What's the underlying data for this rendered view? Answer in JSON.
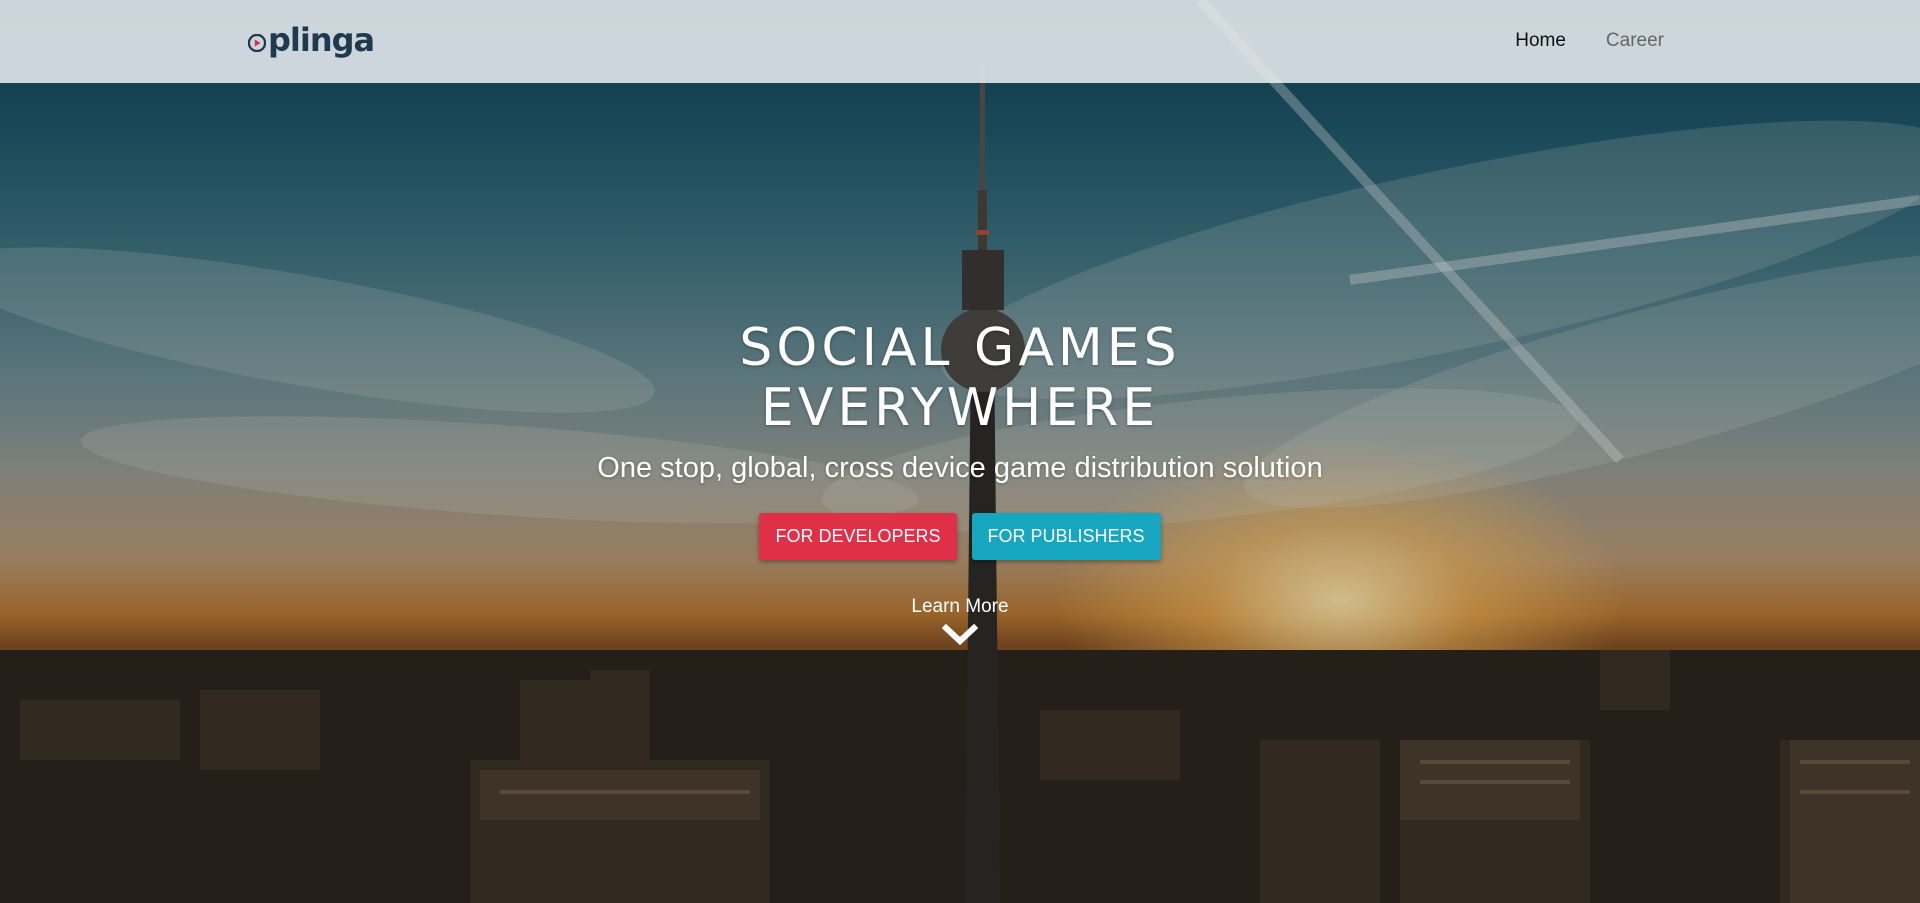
{
  "nav": {
    "logo_text": "plinga",
    "links": [
      {
        "label": "Home",
        "active": true
      },
      {
        "label": "Career",
        "active": false
      }
    ]
  },
  "hero": {
    "headline_line1": "SOCIAL GAMES",
    "headline_line2": "EVERYWHERE",
    "subtitle": "One stop, global, cross device game distribution solution",
    "buttons": {
      "developers": "FOR DEVELOPERS",
      "publishers": "FOR PUBLISHERS"
    },
    "learn_more": "Learn More"
  },
  "colors": {
    "developers_button": "#e03047",
    "publishers_button": "#17a6c0",
    "logo": "#1f3a4f"
  },
  "icons": {
    "logo_mark": "play-circle-icon",
    "scroll_hint": "chevron-down-icon"
  }
}
